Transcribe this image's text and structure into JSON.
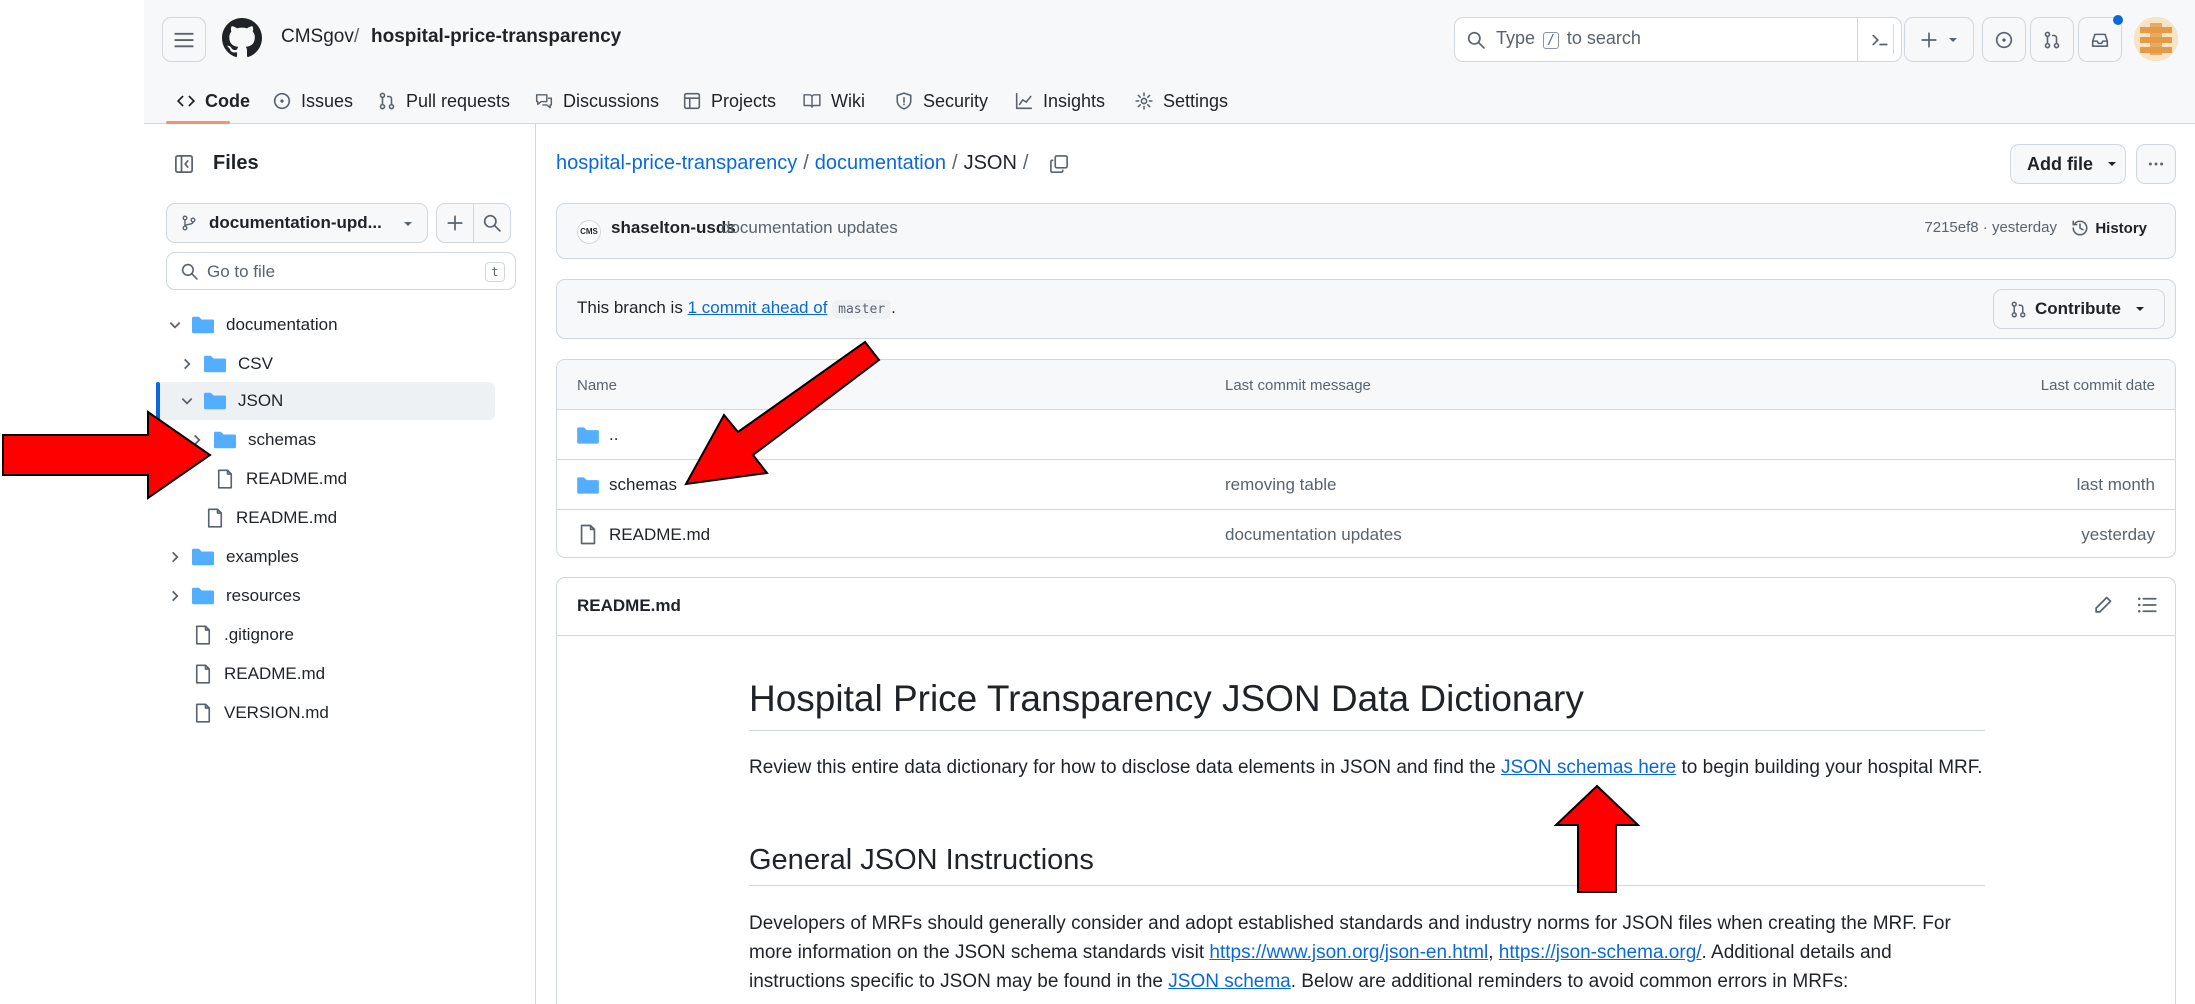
{
  "header": {
    "owner": "CMSgov",
    "separator": "/",
    "repo": "hospital-price-transparency",
    "search_prefix": "Type",
    "search_key": "/",
    "search_suffix": "to search"
  },
  "tabs": [
    {
      "label": "Code",
      "icon": "code-icon"
    },
    {
      "label": "Issues",
      "icon": "issue-icon"
    },
    {
      "label": "Pull requests",
      "icon": "pull-request-icon"
    },
    {
      "label": "Discussions",
      "icon": "discussions-icon"
    },
    {
      "label": "Projects",
      "icon": "projects-icon"
    },
    {
      "label": "Wiki",
      "icon": "book-icon"
    },
    {
      "label": "Security",
      "icon": "shield-icon"
    },
    {
      "label": "Insights",
      "icon": "graph-icon"
    },
    {
      "label": "Settings",
      "icon": "gear-icon"
    }
  ],
  "sidebar": {
    "title": "Files",
    "branch": "documentation-upd...",
    "goto_placeholder": "Go to file",
    "goto_key": "t",
    "tree": [
      {
        "label": "documentation",
        "type": "folder",
        "expanded": true
      },
      {
        "label": "CSV",
        "type": "folder",
        "expanded": false
      },
      {
        "label": "JSON",
        "type": "folder",
        "expanded": true,
        "selected": true
      },
      {
        "label": "schemas",
        "type": "folder",
        "expanded": false
      },
      {
        "label": "README.md",
        "type": "file"
      },
      {
        "label": "README.md",
        "type": "file"
      },
      {
        "label": "examples",
        "type": "folder",
        "expanded": false
      },
      {
        "label": "resources",
        "type": "folder",
        "expanded": false
      },
      {
        "label": ".gitignore",
        "type": "file"
      },
      {
        "label": "README.md",
        "type": "file"
      },
      {
        "label": "VERSION.md",
        "type": "file"
      }
    ]
  },
  "breadcrumb": {
    "repo": "hospital-price-transparency",
    "folder": "documentation",
    "current": "JSON",
    "sep": "/"
  },
  "actions": {
    "add_file": "Add file",
    "contribute": "Contribute"
  },
  "commit": {
    "author": "shaselton-usds",
    "message": "documentation updates",
    "meta": "7215ef8 · yesterday",
    "history": "History",
    "avatar_text": "CMS"
  },
  "branch_status": {
    "prefix": "This branch is",
    "link": "1 commit ahead of",
    "base": "master",
    "suffix": "."
  },
  "table": {
    "headers": {
      "name": "Name",
      "message": "Last commit message",
      "date": "Last commit date"
    },
    "rows": [
      {
        "name": "..",
        "type": "folder",
        "message": "",
        "date": ""
      },
      {
        "name": "schemas",
        "type": "folder",
        "message": "removing table",
        "date": "last month"
      },
      {
        "name": "README.md",
        "type": "file",
        "message": "documentation updates",
        "date": "yesterday"
      }
    ]
  },
  "readme": {
    "filename": "README.md",
    "h1": "Hospital Price Transparency JSON Data Dictionary",
    "p1_a": "Review this entire data dictionary for how to disclose data elements in JSON and find the ",
    "p1_link": "JSON schemas here",
    "p1_b": " to begin building your hospital MRF.",
    "h2": "General JSON Instructions",
    "p2_a": "Developers of MRFs should generally consider and adopt established standards and industry norms for JSON files when creating the MRF. For more information on the JSON schema standards visit ",
    "p2_link1": "https://www.json.org/json-en.html",
    "p2_comma": ", ",
    "p2_link2": "https://json-schema.org/",
    "p2_b": ". Additional details and instructions specific to JSON may be found in the ",
    "p2_link3": "JSON schema",
    "p2_c": ". Below are additional reminders to avoid common errors in MRFs:"
  },
  "colors": {
    "link": "#0969da",
    "folder": "#54aeff",
    "border": "#d0d7de",
    "annotation_arrow": "#ff0000",
    "tab_underline": "#fd8c73"
  }
}
